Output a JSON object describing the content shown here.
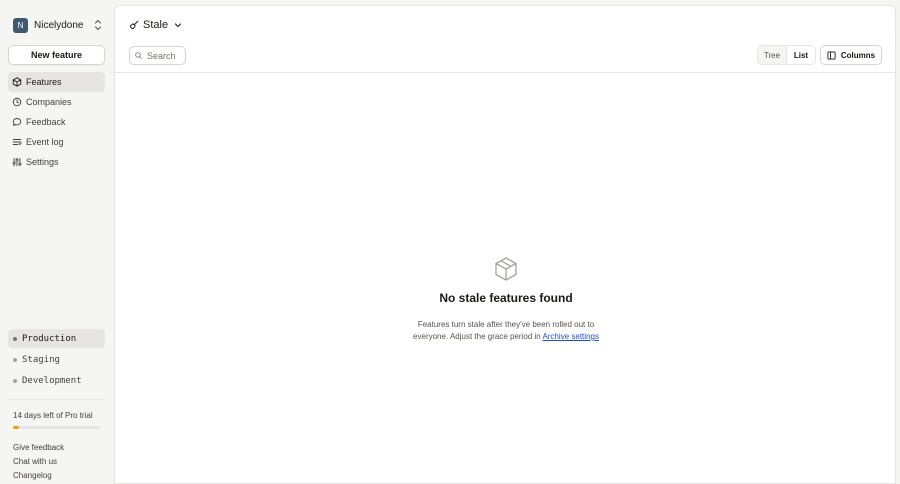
{
  "workspace": {
    "initial": "N",
    "name": "Nicelydone"
  },
  "sidebar": {
    "new_feature_label": "New feature",
    "items": [
      {
        "label": "Features",
        "icon": "box-icon",
        "active": true
      },
      {
        "label": "Companies",
        "icon": "building-icon",
        "active": false
      },
      {
        "label": "Feedback",
        "icon": "chat-bubble-icon",
        "active": false
      },
      {
        "label": "Event log",
        "icon": "list-icon",
        "active": false
      },
      {
        "label": "Settings",
        "icon": "sliders-icon",
        "active": false
      }
    ],
    "environments": [
      {
        "name": "Production",
        "active": true,
        "color": "#78716c"
      },
      {
        "name": "Staging",
        "active": false,
        "color": "#a8a29e"
      },
      {
        "name": "Development",
        "active": false,
        "color": "#a8a29e"
      }
    ],
    "trial": {
      "text": "14 days left of Pro trial",
      "progress_percent": 7,
      "color": "#f59e0b"
    },
    "footer_links": [
      "Give feedback",
      "Chat with us",
      "Changelog"
    ]
  },
  "header": {
    "view_title": "Stale",
    "view_icon": "broom-icon"
  },
  "toolbar": {
    "search_placeholder": "Search",
    "view_modes": [
      {
        "label": "Tree",
        "active": false
      },
      {
        "label": "List",
        "active": true
      }
    ],
    "columns_label": "Columns"
  },
  "empty_state": {
    "icon": "box-icon",
    "title": "No stale features found",
    "description": "Features turn stale after they've been rolled out to everyone. Adjust the grace period in ",
    "link_label": "Archive settings"
  },
  "colors": {
    "accent_link": "#1d4ed8",
    "trial_bar": "#f59e0b"
  }
}
